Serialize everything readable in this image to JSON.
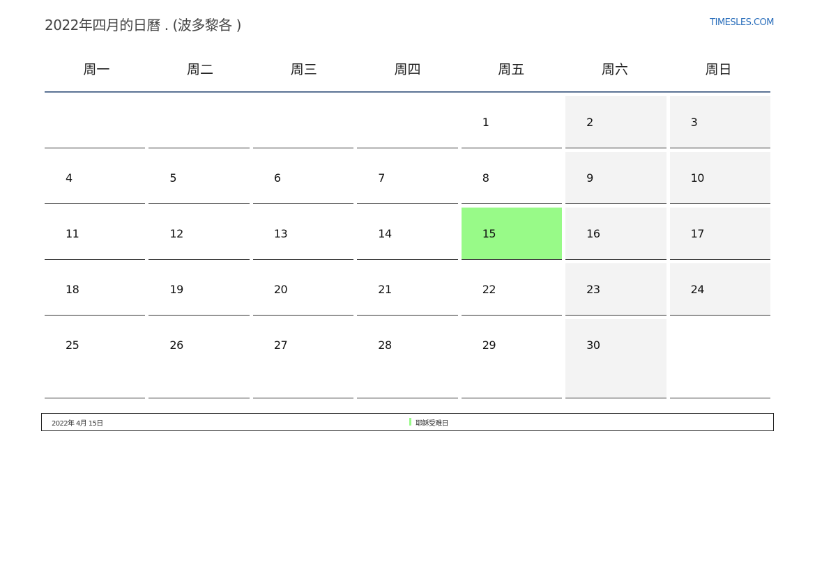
{
  "header": {
    "title": "2022年四月的日曆 . (波多黎各 )",
    "site": "TIMESLES.COM"
  },
  "calendar": {
    "weekdays": [
      "周一",
      "周二",
      "周三",
      "周四",
      "周五",
      "周六",
      "周日"
    ],
    "weeks": [
      [
        "",
        "",
        "",
        "",
        "1",
        "2",
        "3"
      ],
      [
        "4",
        "5",
        "6",
        "7",
        "8",
        "9",
        "10"
      ],
      [
        "11",
        "12",
        "13",
        "14",
        "15",
        "16",
        "17"
      ],
      [
        "18",
        "19",
        "20",
        "21",
        "22",
        "23",
        "24"
      ],
      [
        "25",
        "26",
        "27",
        "28",
        "29",
        "30",
        ""
      ]
    ],
    "holiday_day": "15",
    "colors": {
      "holiday": "#98fa88",
      "weekend": "#f3f3f3",
      "header_rule": "#5b7394",
      "link": "#2a6ebb"
    }
  },
  "legend": {
    "date": "2022年 4月 15日",
    "holiday_name": "耶稣受难日",
    "marker_color": "#98fa88"
  }
}
